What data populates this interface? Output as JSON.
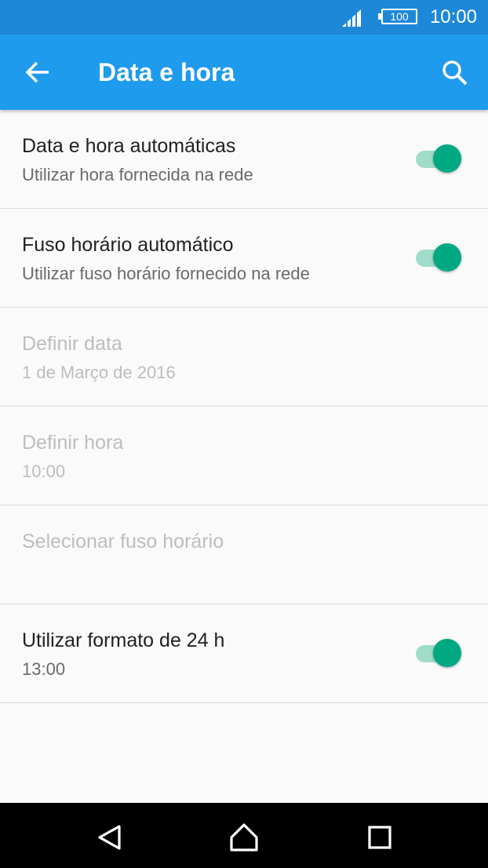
{
  "status_bar": {
    "time": "10:00",
    "battery_level": "100",
    "signal_icon": "signal-icon",
    "color": "#1e88d8"
  },
  "app_bar": {
    "title": "Data e hora",
    "back_icon": "arrow-back-icon",
    "search_icon": "search-icon",
    "color": "#1e9bec"
  },
  "settings": [
    {
      "title": "Data e hora automáticas",
      "summary": "Utilizar hora fornecida na rede",
      "toggle": true,
      "enabled": true
    },
    {
      "title": "Fuso horário automático",
      "summary": "Utilizar fuso horário fornecido na rede",
      "toggle": true,
      "enabled": true
    },
    {
      "title": "Definir data",
      "summary": "1 de Março de 2016",
      "enabled": false
    },
    {
      "title": "Definir hora",
      "summary": "10:00",
      "enabled": false
    },
    {
      "title": "Selecionar fuso horário",
      "summary": "",
      "enabled": false
    },
    {
      "title": "Utilizar formato de 24 h",
      "summary": "13:00",
      "toggle": true,
      "enabled": true
    }
  ],
  "toggle_color": "#00a982",
  "nav_bar": {
    "back_icon": "nav-back-icon",
    "home_icon": "home-icon",
    "recents_icon": "recents-icon"
  }
}
